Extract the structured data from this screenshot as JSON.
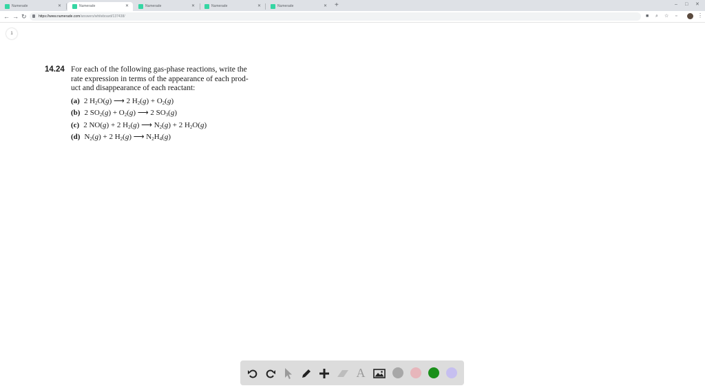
{
  "browser": {
    "tabs": [
      {
        "label": "Numerade",
        "active": false
      },
      {
        "label": "Numerade",
        "active": true
      },
      {
        "label": "Numerade",
        "active": false
      },
      {
        "label": "Numerade",
        "active": false
      },
      {
        "label": "Numerade",
        "active": false
      }
    ],
    "new_tab": "+",
    "url_prefix": "https://www.numerade.com",
    "url_path": "/answers/whiteboard/137438/"
  },
  "page": {
    "page_number": "1",
    "problem": {
      "number": "14.24",
      "text_lines": [
        "For each of the following gas-phase reactions, write the",
        "rate expression in terms of the appearance of each prod-",
        "uct and disappearance of each reactant:"
      ],
      "reactions": [
        {
          "label": "(a)"
        },
        {
          "label": "(b)"
        },
        {
          "label": "(c)"
        },
        {
          "label": "(d)"
        }
      ]
    }
  },
  "drawing_toolbar": {
    "tools": [
      "undo-icon",
      "redo-icon",
      "pointer-icon",
      "pencil-icon",
      "plus-icon",
      "eraser-icon",
      "text-icon",
      "image-icon"
    ],
    "colors": [
      "#a7a7a7",
      "#e7b6bb",
      "#1a8f1a",
      "#c6bff0"
    ]
  }
}
